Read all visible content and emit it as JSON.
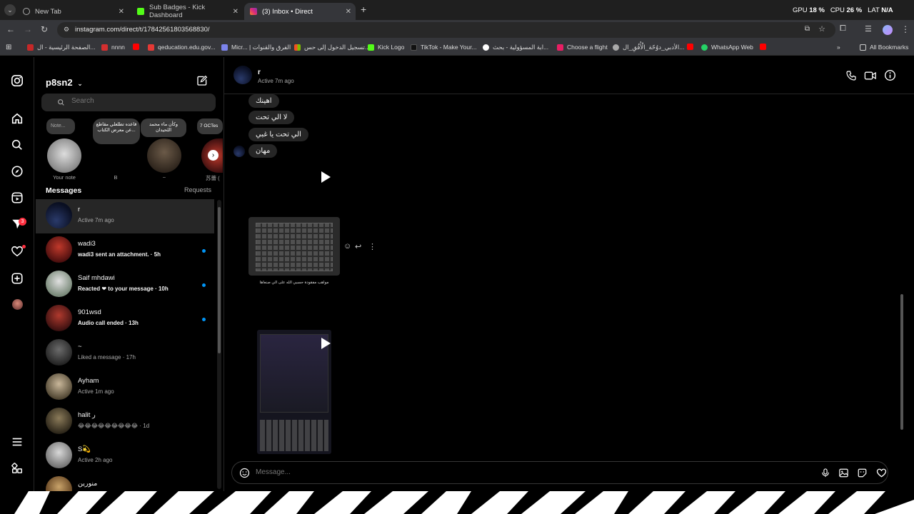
{
  "browser": {
    "tabs": [
      {
        "title": "New Tab"
      },
      {
        "title": "Sub Badges - Kick Dashboard"
      },
      {
        "title": "(3) Inbox • Direct"
      }
    ],
    "url": "instagram.com/direct/t/17842561803568830/",
    "status": {
      "gpu_label": "GPU",
      "gpu_value": "18 %",
      "cpu_label": "CPU",
      "cpu_value": "26 %",
      "lat_label": "LAT",
      "lat_value": "N/A"
    },
    "bookmarks": [
      "الصفحة الرئيسية - ال...",
      "nnnn",
      "qeducation.edu.gov...",
      "Micr... | الفرق والقنوات",
      "تسجيل الدخول إلى حس...",
      "Kick Logo",
      "TikTok - Make Your...",
      "ابة المسؤولية - بحث...",
      "Choose a flight",
      "الأدبي_دوُحّة_الْأُفُقِ_ال...",
      "WhatsApp Web"
    ],
    "all_bookmarks": "All Bookmarks"
  },
  "rail": {
    "notification_badge": "3"
  },
  "inbox": {
    "username": "p8sn2",
    "search_placeholder": "Search",
    "notes": [
      {
        "bubble": "Note...",
        "label": "Your note"
      },
      {
        "bubble": "قاعده تطلعلي مقاطع عن معرض الكتاب...",
        "label": "B"
      },
      {
        "bubble": "وكأن ماء محمد اللحيدان",
        "label": "~"
      },
      {
        "bubble": "7 OCTes",
        "label": "苏蕾 ("
      }
    ],
    "messages_heading": "Messages",
    "requests_label": "Requests",
    "conversations": [
      {
        "name": "r",
        "sub": "Active 7m ago",
        "unread": false,
        "bold": false
      },
      {
        "name": "wadi3",
        "sub": "wadi3 sent an attachment. · 5h",
        "unread": true,
        "bold": true
      },
      {
        "name": "Saif mhdawi",
        "sub": "Reacted ❤ to your message · 10h",
        "unread": true,
        "bold": true
      },
      {
        "name": "901wsd",
        "sub": "Audio call ended · 13h",
        "unread": true,
        "bold": true
      },
      {
        "name": "~",
        "sub": "Liked a message · 17h",
        "unread": false,
        "bold": false
      },
      {
        "name": "Ayham",
        "sub": "Active 1m ago",
        "unread": false,
        "bold": false
      },
      {
        "name": "halit ﺭ",
        "sub": "😂😂😂😂😂😂😂😂😂 · 1d",
        "unread": false,
        "bold": false
      },
      {
        "name": "S💫",
        "sub": "Active 2h ago",
        "unread": false,
        "bold": false
      },
      {
        "name": "منورين",
        "sub": "",
        "unread": false,
        "bold": false
      }
    ]
  },
  "chat": {
    "contact_name": "r",
    "contact_status": "Active 7m ago",
    "messages": [
      "اهينك",
      "لا الي تحت",
      "الي تحت يا غبي",
      "مهان"
    ],
    "image_caption": "مواهب مفقودة حسبي الله على الي صنعاها",
    "composer_placeholder": "Message..."
  }
}
